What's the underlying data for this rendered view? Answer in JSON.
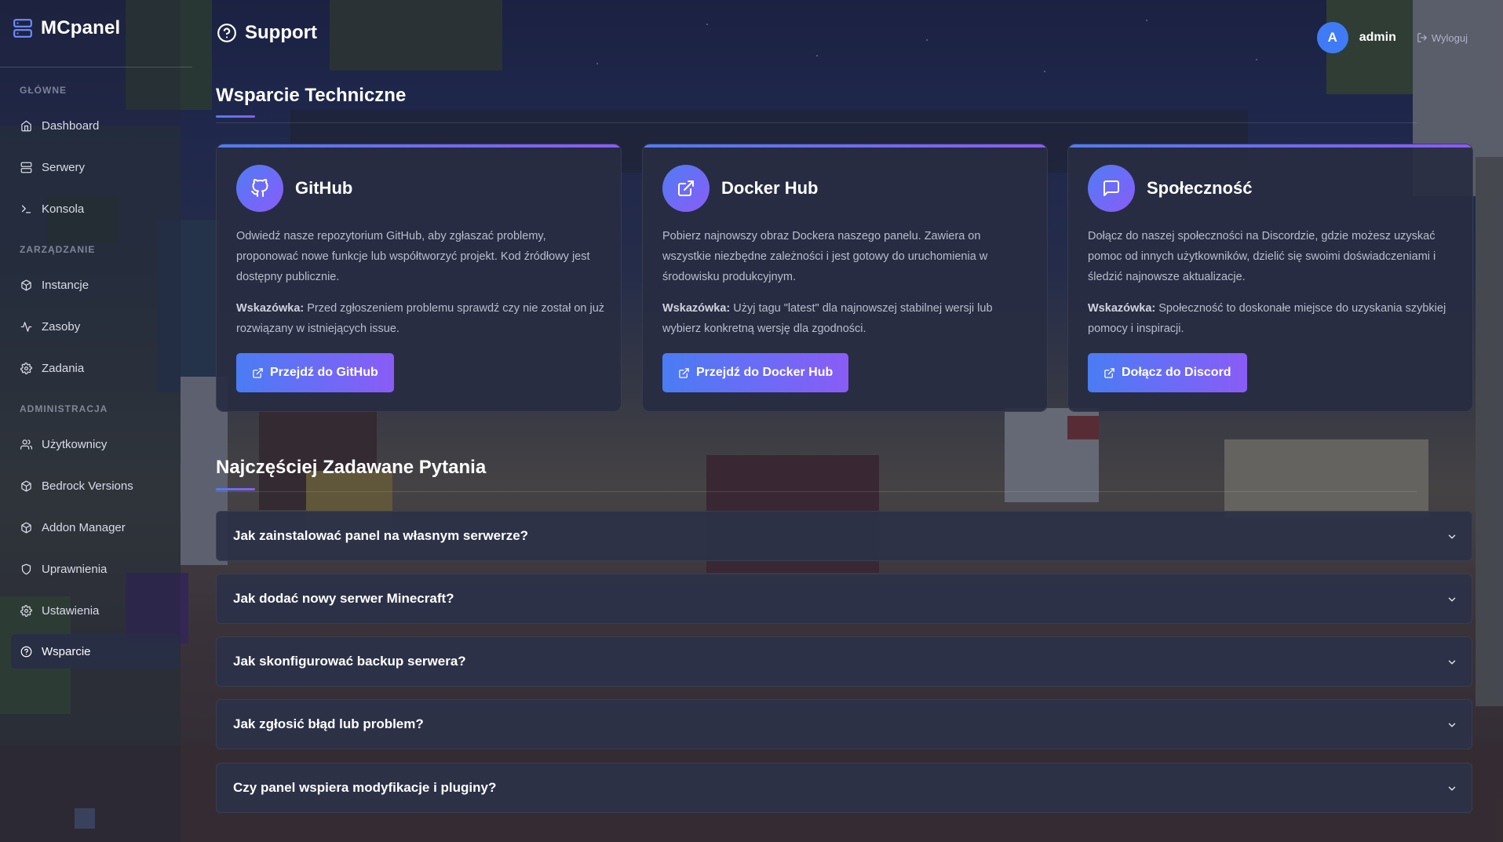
{
  "app": {
    "name": "MCpanel"
  },
  "sidebar": {
    "sections": [
      {
        "label": "GŁÓWNE",
        "items": [
          {
            "label": "Dashboard",
            "icon": "home-icon"
          },
          {
            "label": "Serwery",
            "icon": "server-icon"
          },
          {
            "label": "Konsola",
            "icon": "terminal-icon"
          }
        ]
      },
      {
        "label": "ZARZĄDZANIE",
        "items": [
          {
            "label": "Instancje",
            "icon": "box-icon"
          },
          {
            "label": "Zasoby",
            "icon": "activity-icon"
          },
          {
            "label": "Zadania",
            "icon": "cog-icon"
          }
        ]
      },
      {
        "label": "ADMINISTRACJA",
        "items": [
          {
            "label": "Użytkownicy",
            "icon": "users-icon"
          },
          {
            "label": "Bedrock Versions",
            "icon": "box-icon"
          },
          {
            "label": "Addon Manager",
            "icon": "box-icon"
          },
          {
            "label": "Uprawnienia",
            "icon": "shield-icon"
          },
          {
            "label": "Ustawienia",
            "icon": "settings-icon"
          },
          {
            "label": "Wsparcie",
            "icon": "help-circle-icon",
            "active": true
          }
        ]
      }
    ]
  },
  "header": {
    "title": "Support",
    "user": {
      "avatar_letter": "A",
      "name": "admin",
      "avatar_color": "#3f7bf5"
    },
    "logout_label": "Wyloguj"
  },
  "support": {
    "title": "Wsparcie Techniczne",
    "cards": [
      {
        "title": "GitHub",
        "icon": "github-icon",
        "description": "Odwiedź nasze repozytorium GitHub, aby zgłaszać problemy, proponować nowe funkcje lub współtworzyć projekt. Kod źródłowy jest dostępny publicznie.",
        "tip_label": "Wskazówka:",
        "tip": "Przed zgłoszeniem problemu sprawdź czy nie został on już rozwiązany w istniejących issue.",
        "button": "Przejdź do GitHub"
      },
      {
        "title": "Docker Hub",
        "icon": "external-link-icon",
        "description": "Pobierz najnowszy obraz Dockera naszego panelu. Zawiera on wszystkie niezbędne zależności i jest gotowy do uruchomienia w środowisku produkcyjnym.",
        "tip_label": "Wskazówka:",
        "tip": "Użyj tagu \"latest\" dla najnowszej stabilnej wersji lub wybierz konkretną wersję dla zgodności.",
        "button": "Przejdź do Docker Hub"
      },
      {
        "title": "Społeczność",
        "icon": "message-square-icon",
        "description": "Dołącz do naszej społeczności na Discordzie, gdzie możesz uzyskać pomoc od innych użytkowników, dzielić się swoimi doświadczeniami i śledzić najnowsze aktualizacje.",
        "tip_label": "Wskazówka:",
        "tip": "Społeczność to doskonałe miejsce do uzyskania szybkiej pomocy i inspiracji.",
        "button": "Dołącz do Discord"
      }
    ]
  },
  "faq": {
    "title": "Najczęściej Zadawane Pytania",
    "items": [
      "Jak zainstalować panel na własnym serwerze?",
      "Jak dodać nowy serwer Minecraft?",
      "Jak skonfigurować backup serwera?",
      "Jak zgłosić błąd lub problem?",
      "Czy panel wspiera modyfikacje i pluginy?"
    ]
  },
  "colors": {
    "accent_start": "#4f7cf5",
    "accent_end": "#8a5cf6"
  }
}
